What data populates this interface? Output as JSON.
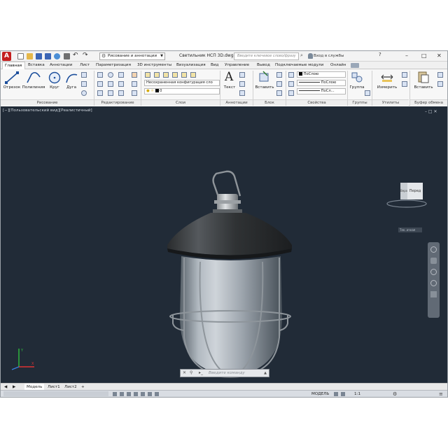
{
  "app": {
    "workspace": "Рисование и аннотации",
    "document_title": "Светильник НСП 3D.dwg",
    "search_placeholder": "Введите ключевое слово/фразу",
    "signin": "Вход в службы"
  },
  "tabs": [
    "Главная",
    "Вставка",
    "Аннотации",
    "Лист",
    "Параметризация",
    "3D инструменты",
    "Визуализация",
    "Вид",
    "Управление",
    "Вывод",
    "Подключаемые модули",
    "Онлайн"
  ],
  "ribbon": {
    "draw": {
      "title": "Рисование",
      "line": "Отрезок",
      "polyline": "Полилиния",
      "circle": "Круг",
      "arc": "Дуга"
    },
    "modify": {
      "title": "Редактирование"
    },
    "layers": {
      "title": "Слои",
      "state": "Несохраненная конфигурация сло",
      "current": "0"
    },
    "annotation": {
      "title": "Аннотации",
      "text": "Текст"
    },
    "block": {
      "title": "Блок",
      "insert": "Вставить"
    },
    "properties": {
      "title": "Свойства",
      "color": "ПоСлою",
      "linetype": "ПоСлою",
      "lineweight": "ПоСл..."
    },
    "groups": {
      "title": "Группы",
      "group": "Группа"
    },
    "utilities": {
      "title": "Утилиты",
      "measure": "Измерить"
    },
    "clipboard": {
      "title": "Буфер обмена",
      "paste": "Вставить"
    }
  },
  "viewport": {
    "label": "[−][Пользовательский вид][Реалистичный]",
    "viewcube_top": "Верх",
    "viewcube_front": "Перед",
    "wcs": "Тек. ичная"
  },
  "command": {
    "placeholder": "Введите команду"
  },
  "layout_tabs": [
    "Модель",
    "Лист1",
    "Лист2"
  ],
  "status": {
    "model": "МОДЕЛЬ",
    "scale": "1:1"
  },
  "colors": {
    "viewport_bg": "#212b37",
    "ribbon_bg": "#f7f7f7",
    "accent": "#c41f1f"
  }
}
